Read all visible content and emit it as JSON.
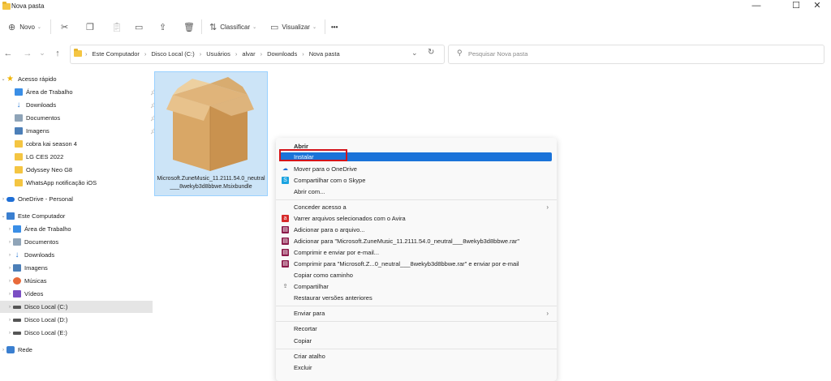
{
  "window": {
    "title": "Nova pasta",
    "controls": [
      "—",
      "☐",
      "✕"
    ]
  },
  "toolbar": {
    "new_label": "Novo",
    "sort_label": "Classificar",
    "view_label": "Visualizar",
    "more_label": "•••"
  },
  "address": {
    "crumbs": [
      "Este Computador",
      "Disco Local (C:)",
      "Usuários",
      "alvar",
      "Downloads",
      "Nova pasta"
    ],
    "search_placeholder": "Pesquisar Nova pasta"
  },
  "sidebar": {
    "quick_access": "Acesso rápido",
    "quick_items": [
      {
        "label": "Área de Trabalho",
        "pinned": true
      },
      {
        "label": "Downloads",
        "pinned": true
      },
      {
        "label": "Documentos",
        "pinned": true
      },
      {
        "label": "Imagens",
        "pinned": true
      },
      {
        "label": "cobra kai season 4",
        "pinned": false
      },
      {
        "label": "LG CES 2022",
        "pinned": false
      },
      {
        "label": "Odyssey Neo G8",
        "pinned": false
      },
      {
        "label": "WhatsApp notificação iOS",
        "pinned": false
      }
    ],
    "onedrive": "OneDrive - Personal",
    "this_pc": "Este Computador",
    "pc_items": [
      {
        "label": "Área de Trabalho"
      },
      {
        "label": "Documentos"
      },
      {
        "label": "Downloads"
      },
      {
        "label": "Imagens"
      },
      {
        "label": "Músicas"
      },
      {
        "label": "Vídeos"
      },
      {
        "label": "Disco Local (C:)"
      },
      {
        "label": "Disco Local (D:)"
      },
      {
        "label": "Disco Local (E:)"
      }
    ],
    "network": "Rede"
  },
  "file": {
    "name": "Microsoft.ZuneMusic_11.2111.54.0_neutral___8wekyb3d8bbwe.Msixbundle"
  },
  "context_menu": {
    "open": "Abrir",
    "install": "Instalar",
    "move_onedrive": "Mover para o OneDrive",
    "share_skype": "Compartilhar com o Skype",
    "open_with": "Abrir com...",
    "grant_access": "Conceder acesso a",
    "avira_scan": "Varrer arquivos selecionados com o Avira",
    "add_archive": "Adicionar para o arquivo...",
    "add_rar": "Adicionar para \"Microsoft.ZuneMusic_11.2111.54.0_neutral___8wekyb3d8bbwe.rar\"",
    "compress_email": "Comprimir e enviar por e-mail...",
    "compress_rar_email": "Comprimir para \"Microsoft.Z...0_neutral___8wekyb3d8bbwe.rar\" e enviar por e-mail",
    "copy_path": "Copiar como caminho",
    "share": "Compartilhar",
    "restore_versions": "Restaurar versões anteriores",
    "send_to": "Enviar para",
    "cut": "Recortar",
    "copy": "Copiar",
    "create_shortcut": "Criar atalho",
    "delete": "Excluir"
  },
  "colors": {
    "accent": "#1a73d9",
    "highlight_box": "#d4141a",
    "selection": "#cce4f7"
  }
}
